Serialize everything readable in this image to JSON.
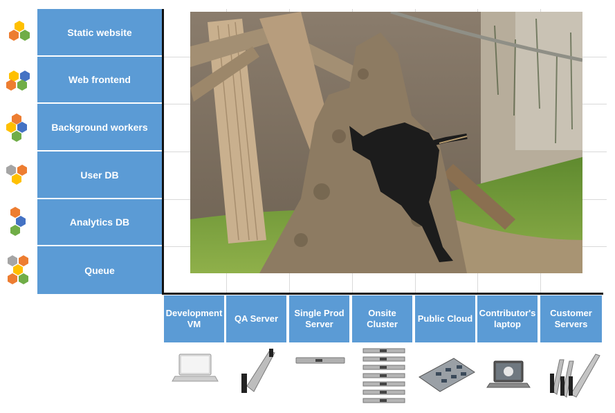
{
  "rows": [
    {
      "label": "Static website"
    },
    {
      "label": "Web frontend"
    },
    {
      "label": "Background workers"
    },
    {
      "label": "User DB"
    },
    {
      "label": "Analytics  DB"
    },
    {
      "label": "Queue"
    }
  ],
  "columns": [
    {
      "label": "Development VM"
    },
    {
      "label": "QA  Server"
    },
    {
      "label": "Single Prod Server"
    },
    {
      "label": "Onsite Cluster"
    },
    {
      "label": "Public Cloud"
    },
    {
      "label": "Contributor's laptop"
    },
    {
      "label": "Customer Servers"
    }
  ],
  "colors": {
    "label_fill": "#5b9bd5",
    "hex_orange": "#ed7d31",
    "hex_yellow": "#ffc000",
    "hex_green": "#70ad47",
    "hex_blue": "#4472c4",
    "hex_gray": "#a5a5a5"
  },
  "icons": {
    "devices": [
      "laptop-icon",
      "blade-server-icon",
      "rack-server-icon",
      "server-cluster-icon",
      "circuit-board-icon",
      "dell-laptop-icon",
      "blade-servers-icon"
    ],
    "row_markers": "hexagon-cluster-icon"
  }
}
